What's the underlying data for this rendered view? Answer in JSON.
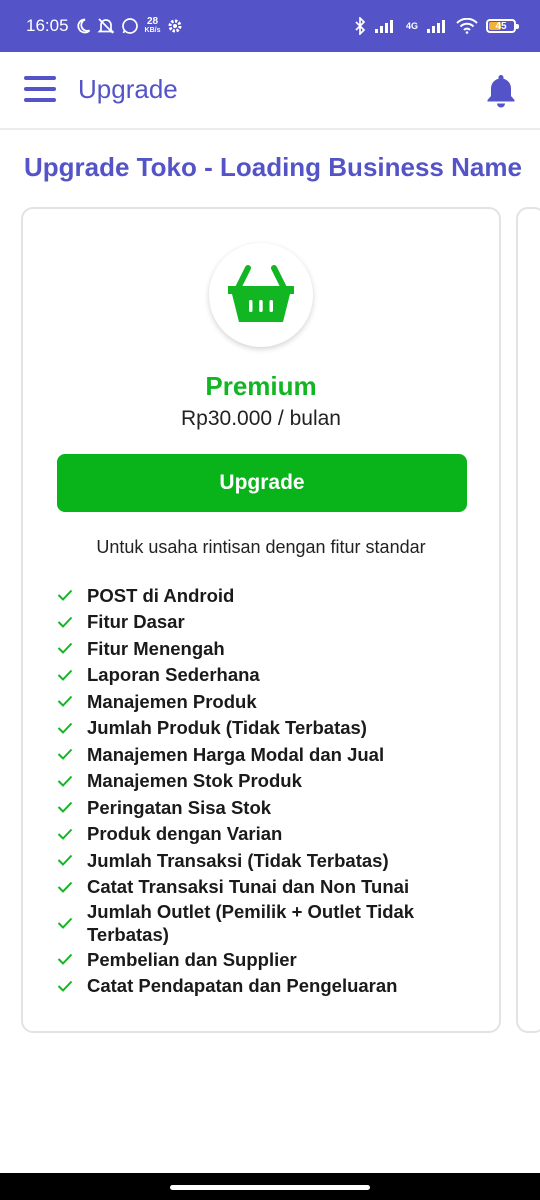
{
  "status_bar": {
    "time": "16:05",
    "net_speed_value": "28",
    "net_speed_unit": "KB/s",
    "network_type": "4G",
    "battery": "45",
    "background_color": "#5454c8"
  },
  "app_bar": {
    "title": "Upgrade",
    "menu_icon": "hamburger-menu-icon",
    "notification_icon": "bell-icon"
  },
  "page": {
    "title": "Upgrade Toko - Loading Business Name"
  },
  "plan": {
    "icon": "shopping-basket-icon",
    "name": "Premium",
    "price": "Rp30.000 / bulan",
    "button_label": "Upgrade",
    "description": "Untuk usaha rintisan dengan fitur standar",
    "accent_color": "#08b41a",
    "features": [
      "POST di Android",
      "Fitur Dasar",
      "Fitur Menengah",
      "Laporan Sederhana",
      "Manajemen Produk",
      "Jumlah Produk (Tidak Terbatas)",
      "Manajemen Harga Modal dan Jual",
      "Manajemen Stok Produk",
      "Peringatan Sisa Stok",
      "Produk dengan Varian",
      "Jumlah Transaksi (Tidak Terbatas)",
      "Catat Transaksi Tunai dan Non Tunai",
      "Jumlah Outlet (Pemilik + Outlet Tidak Terbatas)",
      "Pembelian dan Supplier",
      "Catat Pendapatan dan Pengeluaran"
    ]
  }
}
